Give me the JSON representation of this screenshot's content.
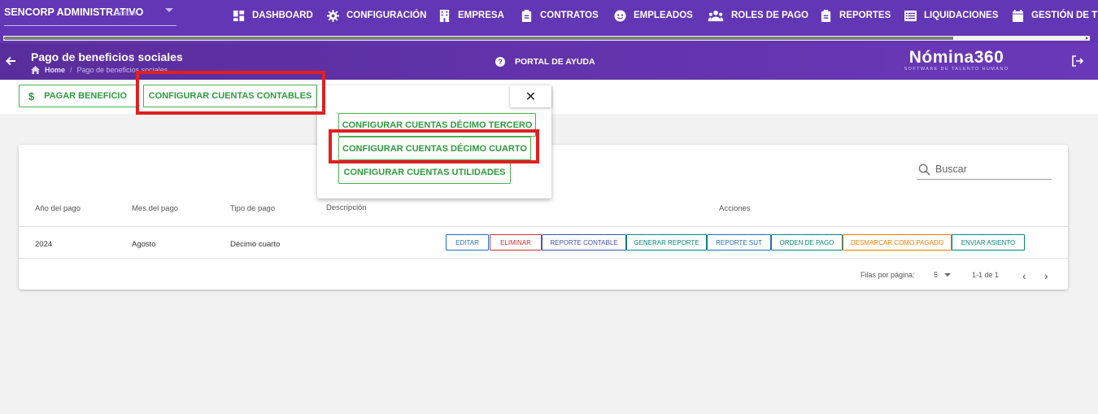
{
  "topbar": {
    "company": "SENCORP ADMINISTRATIVO",
    "company_overlay": "ación",
    "nav": [
      {
        "label": "DASHBOARD",
        "icon": "dashboard-icon"
      },
      {
        "label": "CONFIGURACIÓN",
        "icon": "gear-icon"
      },
      {
        "label": "EMPRESA",
        "icon": "building-icon"
      },
      {
        "label": "CONTRATOS",
        "icon": "clipboard-icon"
      },
      {
        "label": "EMPLEADOS",
        "icon": "face-icon"
      },
      {
        "label": "ROLES DE PAGO",
        "icon": "group-icon"
      },
      {
        "label": "REPORTES",
        "icon": "clipboard-icon"
      },
      {
        "label": "LIQUIDACIONES",
        "icon": "list-icon"
      },
      {
        "label": "GESTIÓN DE T",
        "icon": "calendar-icon"
      }
    ]
  },
  "header": {
    "title": "Pago de beneficios sociales",
    "breadcrumb_home": "Home",
    "breadcrumb_sep": "/",
    "breadcrumb_current": "Pago de beneficios sociales",
    "help": "PORTAL DE AYUDA",
    "help_icon": "?",
    "brand_name": "Nómina360",
    "brand_tag": "SOFTWARE DE TALENTO HUMANO"
  },
  "actions": {
    "pay_icon": "$",
    "pay_label": "PAGAR BENEFICIO",
    "config_label": "CONFIGURAR CUENTAS CONTABLES"
  },
  "popup": {
    "close": "✕",
    "items": [
      "CONFIGURAR CUENTAS DÉCIMO TERCERO",
      "CONFIGURAR CUENTAS DÉCIMO CUARTO",
      "CONFIGURAR CUENTAS UTILIDADES"
    ]
  },
  "table": {
    "search_placeholder": "Buscar",
    "headers": [
      "Año del pago",
      "Mes del pago",
      "Tipo de pago",
      "Descripción",
      "Acciones"
    ],
    "rows": [
      {
        "year": "2024",
        "month": "Agosto",
        "type": "Décimo cuarto",
        "description": ""
      }
    ],
    "row_actions": [
      {
        "label": "EDITAR",
        "color": "#1e6fc2"
      },
      {
        "label": "ELIMINAR",
        "color": "#d32f2f"
      },
      {
        "label": "REPORTE CONTABLE",
        "color": "#3f51b5"
      },
      {
        "label": "GENERAR REPORTE",
        "color": "#00897b"
      },
      {
        "label": "REPORTE SUT",
        "color": "#1e6fc2"
      },
      {
        "label": "ORDEN DE PAGO",
        "color": "#00897b"
      },
      {
        "label": "DESMARCAR COMO PAGADO",
        "color": "#f57c00"
      },
      {
        "label": "ENVIAR ASIENTO",
        "color": "#00897b"
      }
    ],
    "footer": {
      "rows_per_page_label": "Filas por página:",
      "rows_per_page": "5",
      "range": "1-1 de 1",
      "prev": "‹",
      "next": "›"
    }
  },
  "colors": {
    "topbar": "#6236b5",
    "accent_green": "#4caf50",
    "highlight": "#e02020"
  }
}
